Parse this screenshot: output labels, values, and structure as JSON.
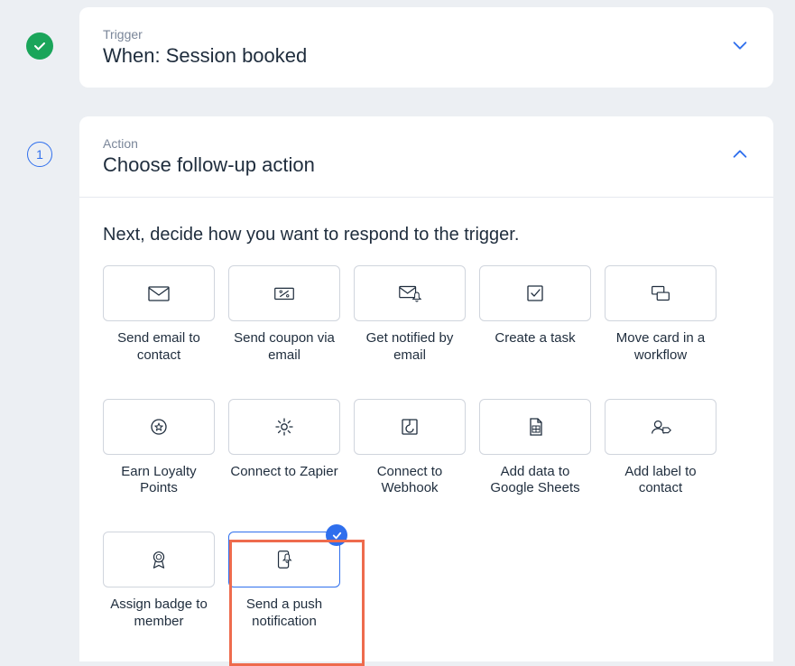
{
  "trigger": {
    "eyebrow": "Trigger",
    "title": "When: Session booked"
  },
  "action": {
    "eyebrow": "Action",
    "title": "Choose follow-up action",
    "step_number": "1",
    "helper": "Next, decide how you want to respond to the trigger.",
    "tiles": [
      {
        "label": "Send email to contact"
      },
      {
        "label": "Send coupon via email"
      },
      {
        "label": "Get notified by email"
      },
      {
        "label": "Create a task"
      },
      {
        "label": "Move card in a workflow"
      },
      {
        "label": "Earn Loyalty Points"
      },
      {
        "label": "Connect to Zapier"
      },
      {
        "label": "Connect to Webhook"
      },
      {
        "label": "Add data to Google Sheets"
      },
      {
        "label": "Add label to contact"
      },
      {
        "label": "Assign badge to member"
      },
      {
        "label": "Send a push notification"
      }
    ]
  }
}
